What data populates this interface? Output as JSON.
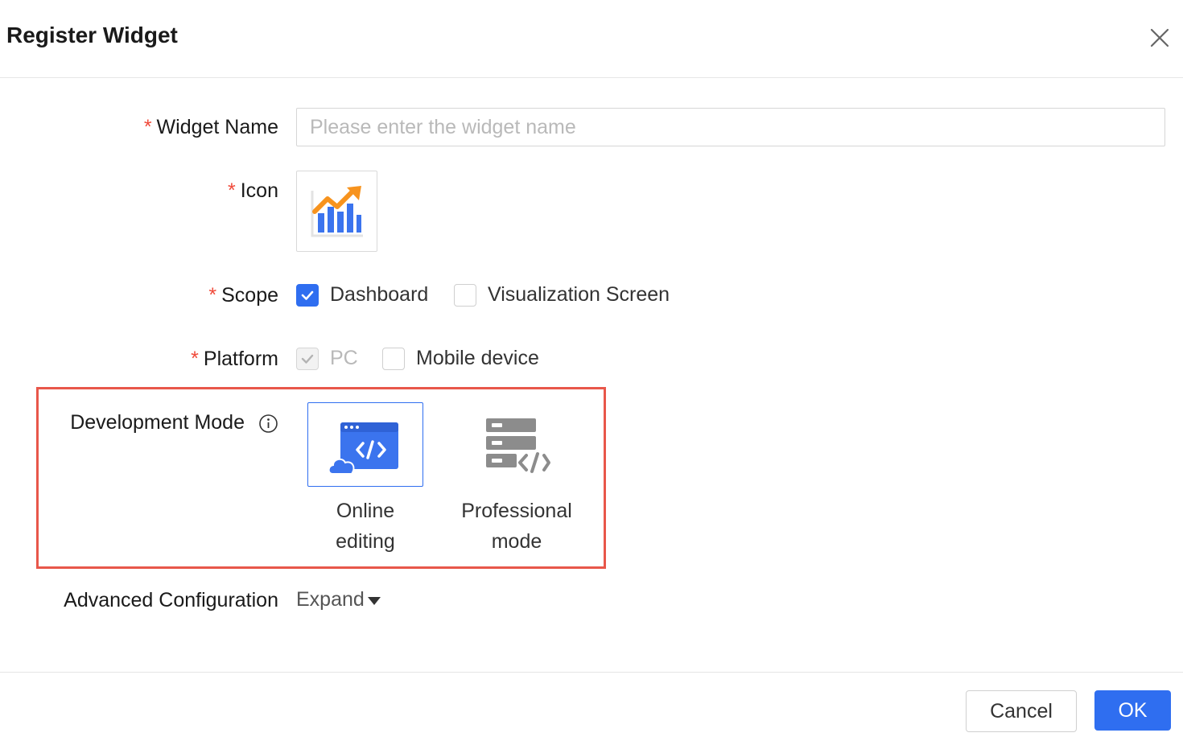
{
  "dialog": {
    "title": "Register Widget",
    "close_icon": "close-icon"
  },
  "form": {
    "widget_name": {
      "label": "Widget Name",
      "required_mark": "*",
      "value": "",
      "placeholder": "Please enter the widget name"
    },
    "icon": {
      "label": "Icon",
      "required_mark": "*",
      "preview_icon": "chart-trend-icon"
    },
    "scope": {
      "label": "Scope",
      "required_mark": "*",
      "options": [
        {
          "label": "Dashboard",
          "checked": true,
          "disabled": false
        },
        {
          "label": "Visualization Screen",
          "checked": false,
          "disabled": false
        }
      ]
    },
    "platform": {
      "label": "Platform",
      "required_mark": "*",
      "options": [
        {
          "label": "PC",
          "checked": true,
          "disabled": true
        },
        {
          "label": "Mobile device",
          "checked": false,
          "disabled": false
        }
      ]
    },
    "development_mode": {
      "label": "Development Mode",
      "info_icon": "info-icon",
      "options": [
        {
          "label_line1": "Online",
          "label_line2": "editing",
          "icon": "cloud-code-icon",
          "selected": true
        },
        {
          "label_line1": "Professional",
          "label_line2": "mode",
          "icon": "server-code-icon",
          "selected": false
        }
      ]
    },
    "advanced_configuration": {
      "label": "Advanced Configuration",
      "toggle_label": "Expand"
    }
  },
  "footer": {
    "cancel_label": "Cancel",
    "ok_label": "OK"
  },
  "colors": {
    "primary": "#2f6ef0",
    "required": "#f04a3a",
    "highlight_border": "#e8574a",
    "icon_orange": "#f7931e",
    "icon_gray": "#8c8c8c"
  }
}
